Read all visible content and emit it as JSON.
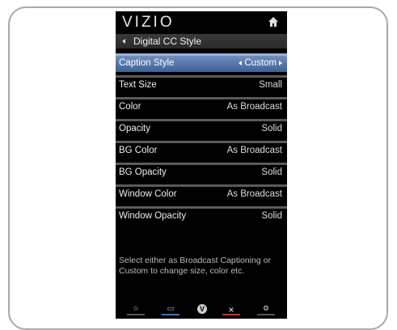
{
  "header": {
    "logo": "VIZIO",
    "home_icon": "home-icon"
  },
  "menu_title": "Digital CC Style",
  "rows": [
    {
      "label": "Caption Style",
      "value": "Custom",
      "selected": true
    },
    {
      "label": "Text Size",
      "value": "Small"
    },
    {
      "label": "Color",
      "value": "As Broadcast"
    },
    {
      "label": "Opacity",
      "value": "Solid"
    },
    {
      "label": "BG Color",
      "value": "As Broadcast"
    },
    {
      "label": "BG Opacity",
      "value": "Solid"
    },
    {
      "label": "Window Color",
      "value": "As Broadcast"
    },
    {
      "label": "Window Opacity",
      "value": "Solid"
    }
  ],
  "help_text": "Select either as Broadcast Captioning or Custom to change size, color etc.",
  "footer": {
    "buttons": [
      {
        "icon": "star-icon",
        "glyph": "☆",
        "color": "#888888"
      },
      {
        "icon": "widget-icon",
        "glyph": "▭",
        "color": "#3d6fd1"
      },
      {
        "icon": "v-icon",
        "glyph": "V",
        "color": "#9a9a9a"
      },
      {
        "icon": "close-icon",
        "glyph": "×",
        "color": "#d32f2f"
      },
      {
        "icon": "settings-icon",
        "glyph": "⚙",
        "color": "#9a9a9a"
      }
    ]
  },
  "colors": {
    "selected_row": "#4f6fa8",
    "background": "#000000"
  }
}
